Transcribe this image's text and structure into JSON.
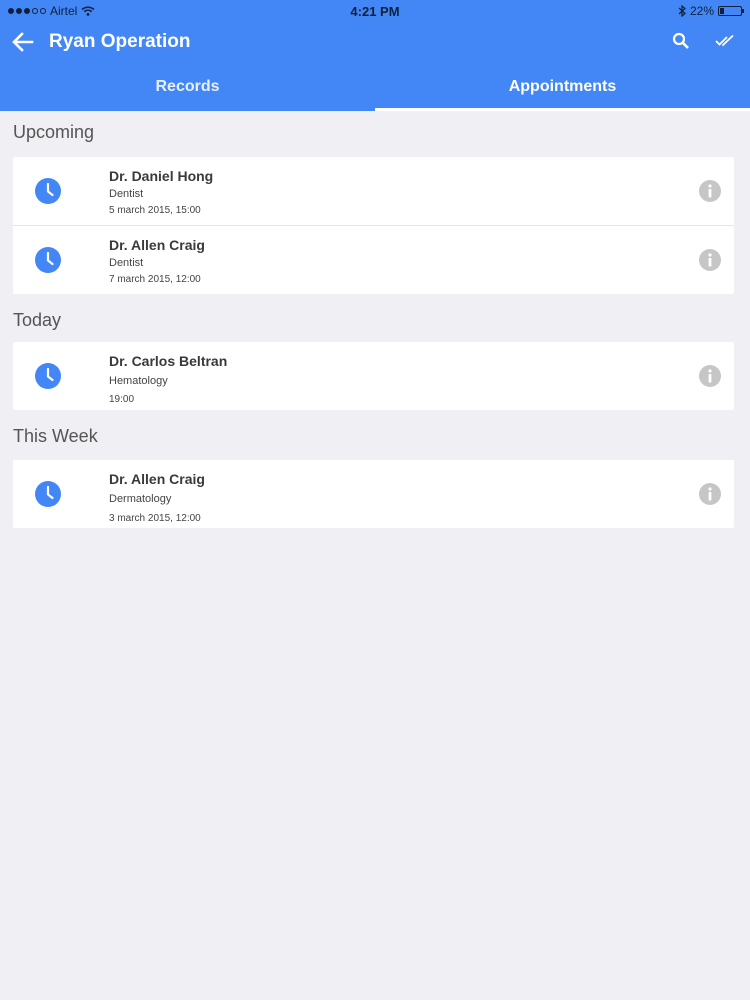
{
  "status": {
    "carrier": "Airtel",
    "time": "4:21 PM",
    "battery": "22%",
    "battery_level": 0.22
  },
  "header": {
    "title": "Ryan Operation"
  },
  "tabs": [
    {
      "label": "Records"
    },
    {
      "label": "Appointments"
    }
  ],
  "sections": [
    {
      "label": "Upcoming",
      "items": [
        {
          "doctor": "Dr. Daniel Hong",
          "specialty": "Dentist",
          "when": "5 march 2015, 15:00"
        },
        {
          "doctor": "Dr. Allen Craig",
          "specialty": "Dentist",
          "when": "7 march 2015, 12:00"
        }
      ]
    },
    {
      "label": "Today",
      "items": [
        {
          "doctor": "Dr. Carlos Beltran",
          "specialty": "Hematology",
          "when": "19:00"
        }
      ]
    },
    {
      "label": "This Week",
      "items": [
        {
          "doctor": "Dr. Allen Craig",
          "specialty": "Dermatology",
          "when": "3 march 2015, 12:00"
        }
      ]
    }
  ],
  "colors": {
    "primary": "#4287f5",
    "icon_blue": "#4287f5",
    "info_gray": "#c6c6c6"
  }
}
